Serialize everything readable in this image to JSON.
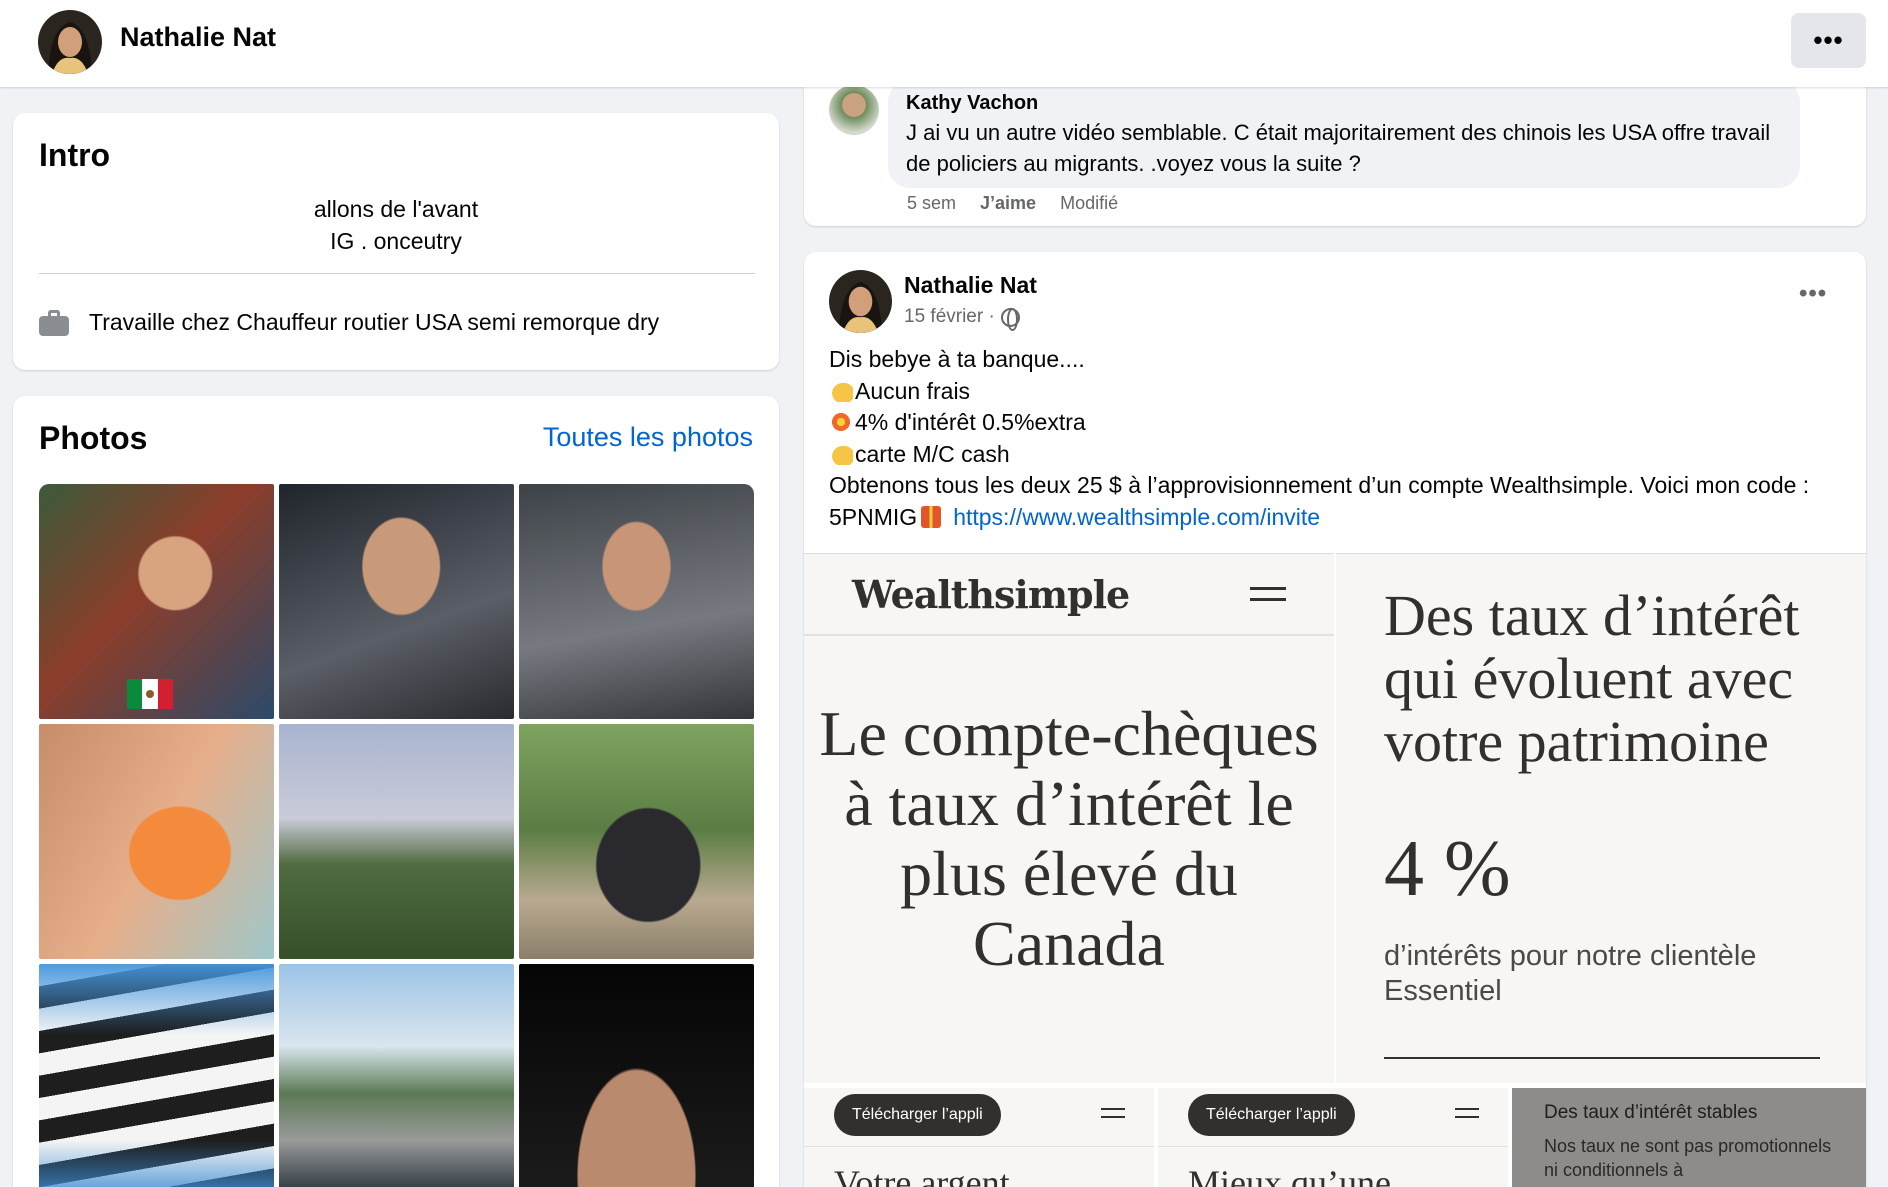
{
  "header": {
    "name": "Nathalie Nat",
    "more_icon": "•••"
  },
  "intro": {
    "title": "Intro",
    "bio_line1": "allons de l'avant",
    "bio_line2": "IG . onceutry",
    "work": "Travaille chez Chauffeur routier USA semi remorque dry"
  },
  "photos": {
    "title": "Photos",
    "see_all": "Toutes les photos"
  },
  "comment": {
    "author": "Kathy Vachon",
    "text": "J ai vu un autre vidéo semblable. C était majoritairement des chinois les USA offre travail de policiers au migrants. .voyez vous la suite ?",
    "time": "5 sem",
    "like": "J’aime",
    "edited": "Modifié"
  },
  "post": {
    "author": "Nathalie Nat",
    "date": "15 février ·",
    "more_icon": "•••",
    "line1": "Dis bebye à ta banque....",
    "line2": "Aucun frais",
    "line3": "4% d'intérêt 0.5%extra",
    "line4": "carte M/C cash",
    "line5": "Obtenons tous les deux 25 $ à l’approvisionnement d’un compte Wealthsimple. Voici mon code :",
    "code": "5PNMIG",
    "link": "https://www.wealthsimple.com/invite"
  },
  "ads": {
    "logo": "Wealthsimple",
    "headline1": "Le compte-chèques à taux d’intérêt le plus élevé du Canada",
    "headline2": "Des taux d’intérêt qui évoluent avec votre patrimoine",
    "percent": "4 %",
    "sub": "d’intérêts pour notre clientèle Essentiel",
    "download1": "Télécharger l’appli",
    "big1": "Votre argent",
    "download2": "Télécharger l’appli",
    "big2": "Mieux qu’une",
    "stable_title": "Des taux d’intérêt stables",
    "stable_text": "Nos taux ne sont pas promotionnels ni conditionnels à"
  }
}
